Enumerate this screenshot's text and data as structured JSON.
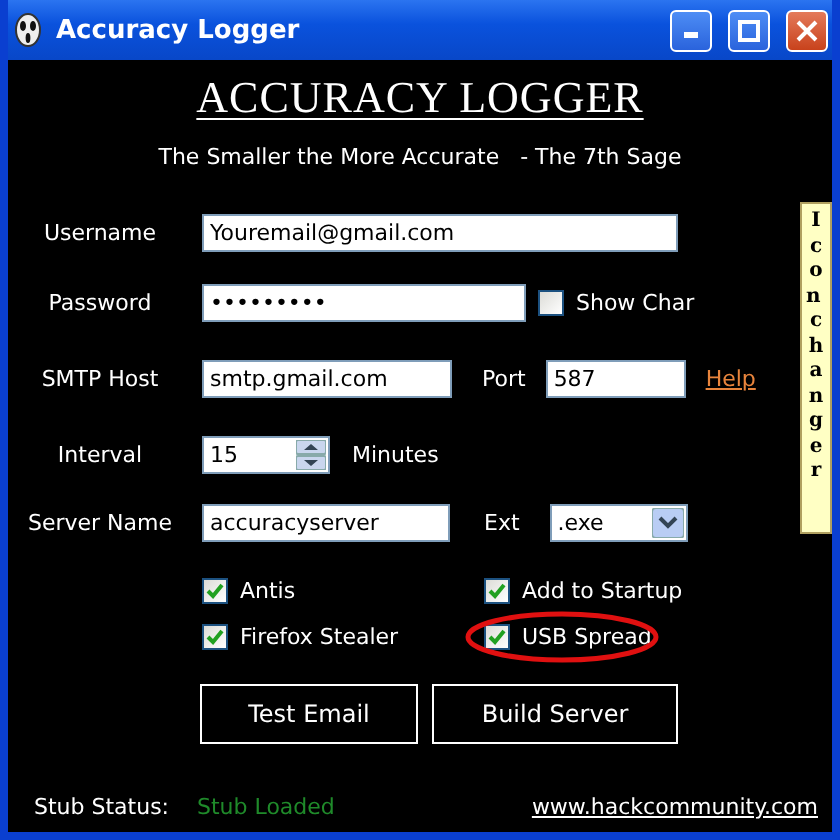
{
  "window": {
    "title": "Accuracy Logger"
  },
  "header": {
    "title": "ACCURACY LOGGER",
    "subtitle": "The Smaller the More Accurate   - The 7th Sage"
  },
  "username": {
    "label": "Username",
    "value": "Youremail@gmail.com"
  },
  "password": {
    "label": "Password",
    "value": "•••••••••",
    "show_char": {
      "label": "Show Char",
      "checked": false
    }
  },
  "smtp": {
    "label": "SMTP Host",
    "value": "smtp.gmail.com",
    "port_label": "Port",
    "port_value": "587",
    "help_link": "Help"
  },
  "interval": {
    "label": "Interval",
    "value": "15",
    "unit": "Minutes"
  },
  "server": {
    "label": "Server Name",
    "value": "accuracyserver",
    "ext_label": "Ext",
    "ext_value": ".exe"
  },
  "options": [
    {
      "label": "Antis",
      "checked": true,
      "circled": false
    },
    {
      "label": "Add to Startup",
      "checked": true,
      "circled": false
    },
    {
      "label": "Firefox Stealer",
      "checked": true,
      "circled": false
    },
    {
      "label": "USB Spread",
      "checked": true,
      "circled": true
    }
  ],
  "buttons": [
    "Test Email",
    "Build Server"
  ],
  "status": {
    "label": "Stub Status:",
    "value": "Stub Loaded",
    "link": "www.hackcommunity.com"
  },
  "side_tab": {
    "label": "Icon changer"
  }
}
